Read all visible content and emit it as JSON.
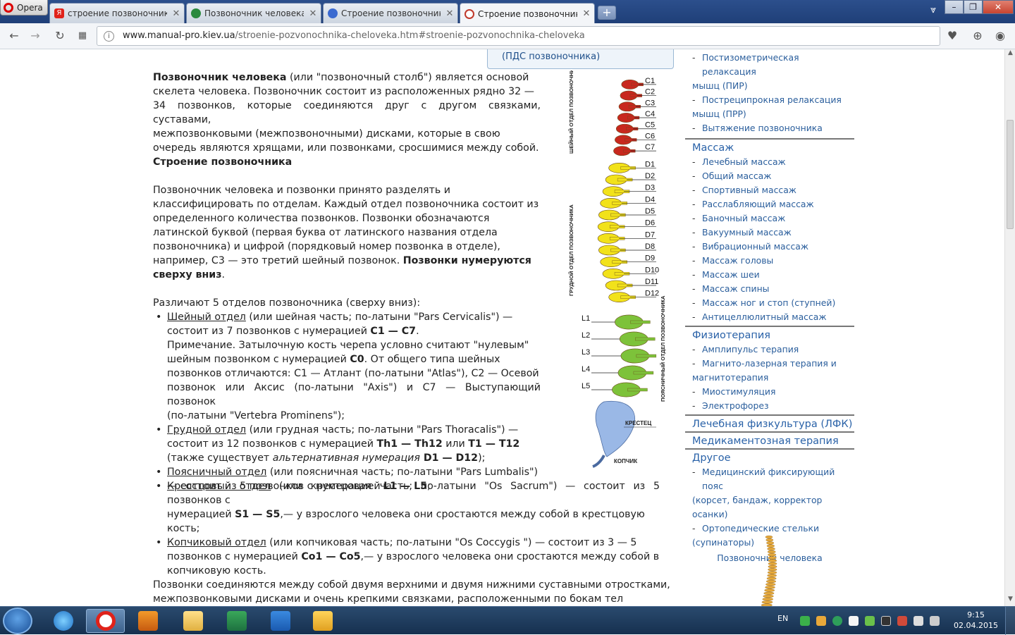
{
  "browser": {
    "menu_label": "Opera",
    "tabs": [
      {
        "title": "строение позвоночника",
        "favicon": "yandex-icon",
        "color": "#e0221a"
      },
      {
        "title": "Позвоночник человека",
        "favicon": "globe-green-icon",
        "color": "#2b8a3e"
      },
      {
        "title": "Строение позвоночника",
        "favicon": "site-icon",
        "color": "#3b6ad0"
      },
      {
        "title": "Строение позвоночника",
        "favicon": "site-icon-red",
        "color": "#c0392b"
      }
    ],
    "new_tab_label": "+",
    "address": {
      "host": "www.manual-pro.kiev.ua",
      "path": "/stroenie-pozvonochnika-cheloveka.htm#stroenie-pozvonochnika-cheloveka"
    }
  },
  "article": {
    "pds_box": "(ПДС позвоночника)",
    "p1_strong": "Позвоночник человека",
    "p1_lines": [
      " (или \"позвоночный столб\") является основой",
      "скелета человека. Позвоночник состоит из расположенных рядно 32 —",
      "34 позвонков, которые соединяются друг с другом связками, суставами,",
      "межпозвонковыми (межпозвоночными) дисками, которые в свою",
      "очередь являются хрящами, или позвонками, сросшимися между собой."
    ],
    "h_structure": "Строение позвоночника",
    "p2_lines": [
      "Позвоночник человека и позвонки принято разделять и",
      "классифицировать по отделам. Каждый отдел позвоночника состоит из",
      "определенного количества позвонков. Позвонки обозначаются",
      "латинской буквой (первая буква от латинского названия отдела",
      "позвоночника) и цифрой (порядковый номер позвонка в отделе),",
      "например, С3 — это третий шейный позвонок. "
    ],
    "p2_strong1": "Позвонки нумеруются",
    "p2_strong2": "сверху вниз",
    "p2_end": ".",
    "p3": "Различают 5 отделов позвоночника (сверху вниз):",
    "list": {
      "cervical_name": "Шейный отдел",
      "cervical_l1": " (или шейная часть; по-латыни \"Pars Cervicalis\") —",
      "cervical_l2": "состоит из 7 позвонков с нумерацией ",
      "cervical_l2b": "С1 — С7",
      "note_l1": "Примечание. Затылочную кость черепа условно считают \"нулевым\"",
      "note_l2": "шейным позвонком с нумерацией ",
      "note_l2b": "С0",
      "note_l2c": ". От общего типа шейных",
      "note_l3": "позвонков отличаются: С1 — Атлант (по-латыни \"Atlas\"), С2 — Осевой",
      "note_l4": "позвонок или Аксис (по-латыни \"Axis\") и С7 — Выступающий позвонок",
      "note_l5": "(по-латыни \"Vertebra Prominens\");",
      "thoracic_name": "Грудной отдел",
      "thoracic_l1": " (или грудная часть; по-латыни \"Pars Thoracalis\") —",
      "thoracic_l2": "состоит из 12 позвонков с нумерацией ",
      "thoracic_l2b": "Th1 — Th12",
      "thoracic_l2c": " или ",
      "thoracic_l2d": "Т1 — Т12",
      "thoracic_l3": "(также существует ",
      "thoracic_l3i": "альтернативная нумерация",
      "thoracic_l3b": " D1 — D12",
      "thoracic_l3c": ");",
      "lumbar_name": "Поясничный отдел",
      "lumbar_l1": " (или поясничная часть; по-латыни \"Pars Lumbalis\")",
      "lumbar_l2": "— состоит из 5 позвонков с нумерацией ",
      "lumbar_l2b": "L1 — L5",
      "lumbar_l2c": ";",
      "sacral_name": "Крестцовый отдел",
      "sacral_l1": " (или крестцовая часть; по-латыни \"Os Sacrum\") — состоит из 5 позвонков с",
      "sacral_l2": "нумерацией ",
      "sacral_l2b": "S1 — S5",
      "sacral_l2c": ",— у взрослого человека они сростаются между собой в крестцовую",
      "sacral_l3": "кость;",
      "coccyx_name": "Копчиковый отдел",
      "coccyx_l1": " (или копчиковая часть; по-латыни \"Os Coccygis \") — состоит из 3 — 5",
      "coccyx_l2": "позвонков с нумерацией ",
      "coccyx_l2b": "Со1 — Со5",
      "coccyx_l2c": ",— у взрослого человека они сростаются между собой в",
      "coccyx_l3": "копчиковую кость."
    },
    "p4_l1": "Позвонки соединяются между собой двумя верхними и двумя нижними суставными отростками,",
    "p4_l2": "межпозвонковыми дисками и очень крепкими связками, расположенными по бокам тел"
  },
  "spine_figure": {
    "labels_c": [
      "C1",
      "C2",
      "C3",
      "C4",
      "C5",
      "C6",
      "C7"
    ],
    "labels_d": [
      "D1",
      "D2",
      "D3",
      "D4",
      "D5",
      "D6",
      "D7",
      "D8",
      "D9",
      "D10",
      "D11",
      "D12"
    ],
    "labels_l": [
      "L1",
      "L2",
      "L3",
      "L4",
      "L5"
    ],
    "cervical_caption": "ШЕЙНЫЙ ОТДЕЛ ПОЗВОНОЧНИКА",
    "thoracic_caption": "ГРУДНОЙ ОТДЕЛ ПОЗВОНОЧНИКА",
    "lumbar_caption": "ПОЯСНИЧНЫЙ ОТДЕЛ ПОЗВОНОЧНИКА",
    "sacrum_caption": "КРЕСТЕЦ",
    "coccyx_caption": "КОПЧИК",
    "colors": {
      "cervical": "#c8281e",
      "thoracic": "#f2e21a",
      "lumbar": "#7dc23a",
      "sacrum": "#9ab8e6"
    }
  },
  "sidebar": {
    "top_items": [
      [
        "Постизометрическая релаксация",
        "мышц (ПИР)"
      ],
      [
        "Постреципрокная релаксация",
        "мышц (ПРР)"
      ],
      [
        "Вытяжение позвоночника"
      ]
    ],
    "massage_head": "Массаж",
    "massage_items": [
      "Лечебный массаж",
      "Общий массаж",
      "Спортивный массаж",
      "Расслабляющий массаж",
      "Баночный массаж",
      "Вакуумный массаж",
      "Вибрационный массаж",
      "Массаж головы",
      "Массаж шеи",
      "Массаж спины",
      "Массаж ног и стоп (ступней)",
      "Антицеллюлитный массаж"
    ],
    "physio_head": "Физиотерапия",
    "physio_items": [
      [
        "Амплипульс терапия"
      ],
      [
        "Магнито-лазерная терапия и",
        "магнитотерапия"
      ],
      [
        "Миостимуляция"
      ],
      [
        "Электрофорез"
      ]
    ],
    "lfk_head": "Лечебная физкультура (ЛФК)",
    "med_head": "Медикаментозная терапия",
    "other_head": "Другое",
    "other_items": [
      [
        "Медицинский фиксирующий пояс",
        "(корсет, бандаж, корректор осанки)"
      ],
      [
        "Ортопедические стельки",
        "(супинаторы)"
      ]
    ],
    "image_caption": "Позвоночник человека"
  },
  "taskbar": {
    "apps": [
      "internet-explorer-icon",
      "opera-icon",
      "media-player-icon",
      "file-explorer-icon",
      "excel-icon",
      "lync-icon",
      "outlook-icon"
    ],
    "lang": "EN",
    "time": "9:15",
    "date": "02.04.2015"
  }
}
